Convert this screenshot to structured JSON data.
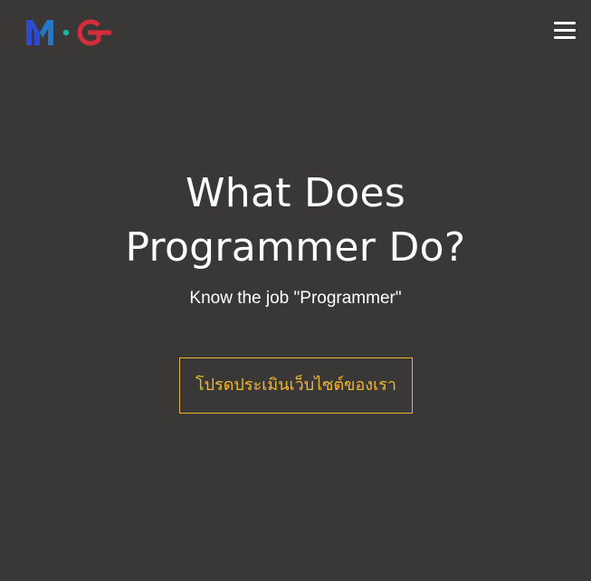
{
  "header": {
    "logo": {
      "text": "M·G",
      "colors": {
        "m": "#2d4ad4",
        "dot": "#1eb5a8",
        "g": "#d22f3a"
      }
    },
    "menu_icon": "hamburger-menu-icon"
  },
  "hero": {
    "title_line1": "What Does",
    "title_line2": "Programmer Do?",
    "subtitle": "Know the job \"Programmer\"",
    "cta_label": "โปรดประเมินเว็บไซต์ของเรา"
  },
  "colors": {
    "background": "#3a3836",
    "text": "#ffffff",
    "accent": "#f2b82d"
  }
}
